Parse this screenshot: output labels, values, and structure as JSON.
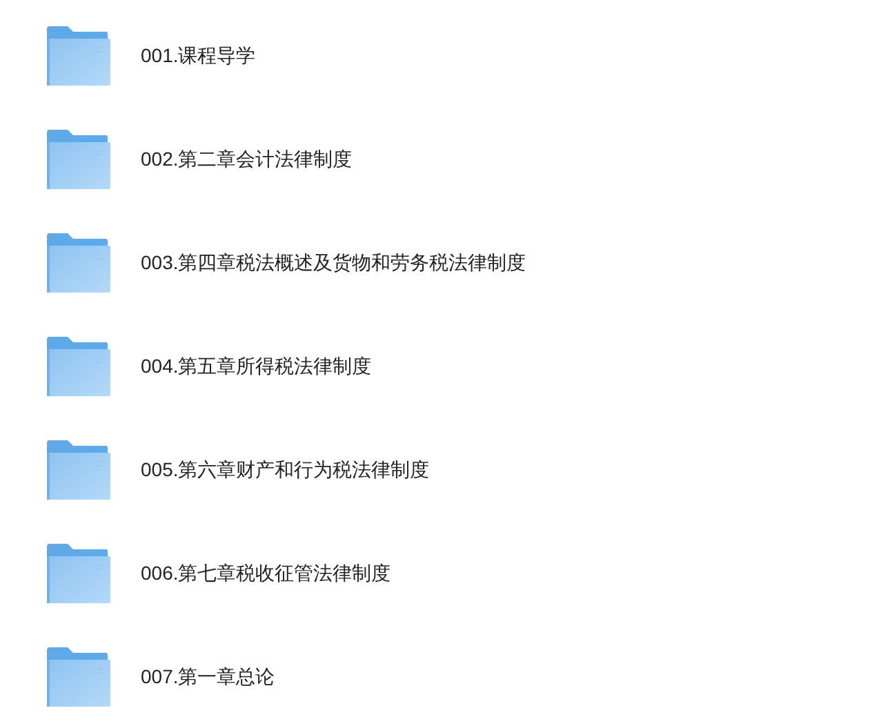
{
  "folders": [
    {
      "name": "001.课程导学"
    },
    {
      "name": "002.第二章会计法律制度"
    },
    {
      "name": "003.第四章税法概述及货物和劳务税法律制度"
    },
    {
      "name": "004.第五章所得税法律制度"
    },
    {
      "name": "005.第六章财产和行为税法律制度"
    },
    {
      "name": "006.第七章税收征管法律制度"
    },
    {
      "name": "007.第一章总论"
    }
  ]
}
